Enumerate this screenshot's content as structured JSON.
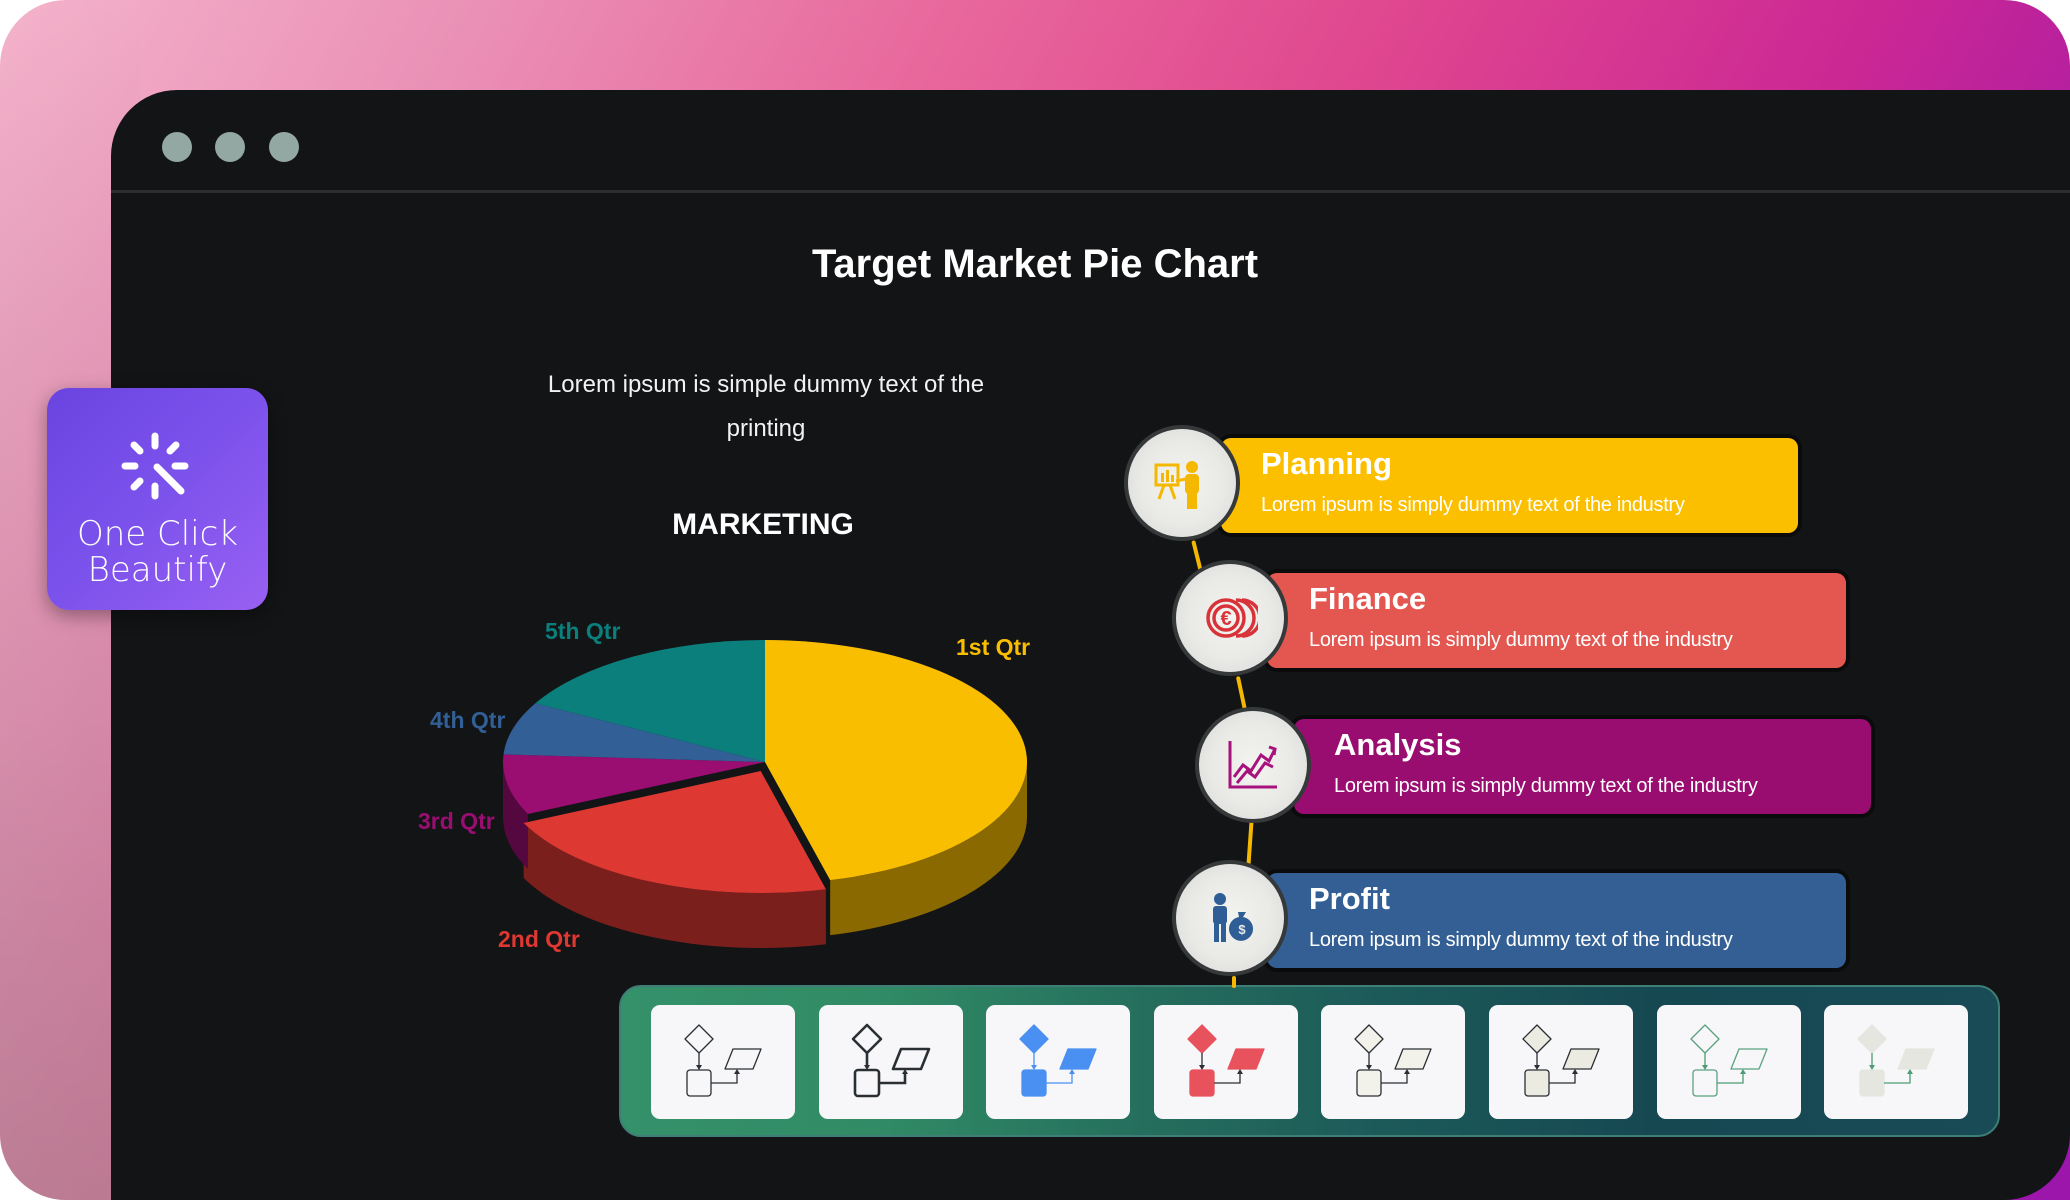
{
  "app": {
    "window_controls": [
      "close",
      "minimize",
      "maximize"
    ],
    "colors": {
      "window_bg": "#131416",
      "dot": "#93a8a3",
      "accent_line": "#f5b800"
    }
  },
  "beautify_button": {
    "label_line1": "One Click",
    "label_line2": "Beautify",
    "icon": "magic-wand-sparkle-icon",
    "color": "#7c52ec"
  },
  "slide": {
    "title": "Target Market Pie Chart",
    "intro_line1": "Lorem ipsum is simple dummy text of the",
    "intro_line2": "printing",
    "chart_heading": "MARKETING"
  },
  "chart_data": {
    "type": "pie",
    "title": "MARKETING",
    "style": "3d",
    "categories": [
      "1st Qtr",
      "2nd Qtr",
      "3rd Qtr",
      "4th Qtr",
      "5th Qtr"
    ],
    "values": [
      46,
      22,
      8,
      7,
      17
    ],
    "unit": "percent (estimated)",
    "colors": [
      "#f9be00",
      "#de3832",
      "#9a0e72",
      "#315f96",
      "#0a7f7c"
    ],
    "exploded": [
      "2nd Qtr"
    ],
    "legend": "none (labels beside slices)"
  },
  "steps": [
    {
      "title": "Planning",
      "desc": "Lorem ipsum is simply dummy text of the industry",
      "color": "#fbbf00",
      "icon": "presentation-icon",
      "icon_color": "#f5b800"
    },
    {
      "title": "Finance",
      "desc": "Lorem ipsum is simply dummy text of the industry",
      "color": "#e35750",
      "icon": "euro-coins-icon",
      "icon_color": "#d9333a"
    },
    {
      "title": "Analysis",
      "desc": "Lorem ipsum is simply dummy text of the industry",
      "color": "#990d70",
      "icon": "growth-chart-icon",
      "icon_color": "#a8127c"
    },
    {
      "title": "Profit",
      "desc": "Lorem ipsum is simply dummy text of the industry",
      "color": "#335f94",
      "icon": "businessman-money-bag-icon",
      "icon_color": "#2f5e97"
    }
  ],
  "template_strip": {
    "items": [
      {
        "name": "outline-thin",
        "fill": "none",
        "stroke": "#2a2f33"
      },
      {
        "name": "outline-bold",
        "fill": "none",
        "stroke": "#2a2f33"
      },
      {
        "name": "blue-filled",
        "fill": "#4a8ff2",
        "stroke": "#4a8ff2"
      },
      {
        "name": "red-filled",
        "fill": "#e8525c",
        "stroke": "#e8525c"
      },
      {
        "name": "cream-outline",
        "fill": "#f3f2ea",
        "stroke": "#2a2f33"
      },
      {
        "name": "beige-outline",
        "fill": "#ecebe2",
        "stroke": "#2a2f33"
      },
      {
        "name": "green-outline",
        "fill": "none",
        "stroke": "#5aa27e"
      },
      {
        "name": "grey-muted",
        "fill": "#e6e6e0",
        "stroke": "#e6e6e0"
      }
    ]
  }
}
